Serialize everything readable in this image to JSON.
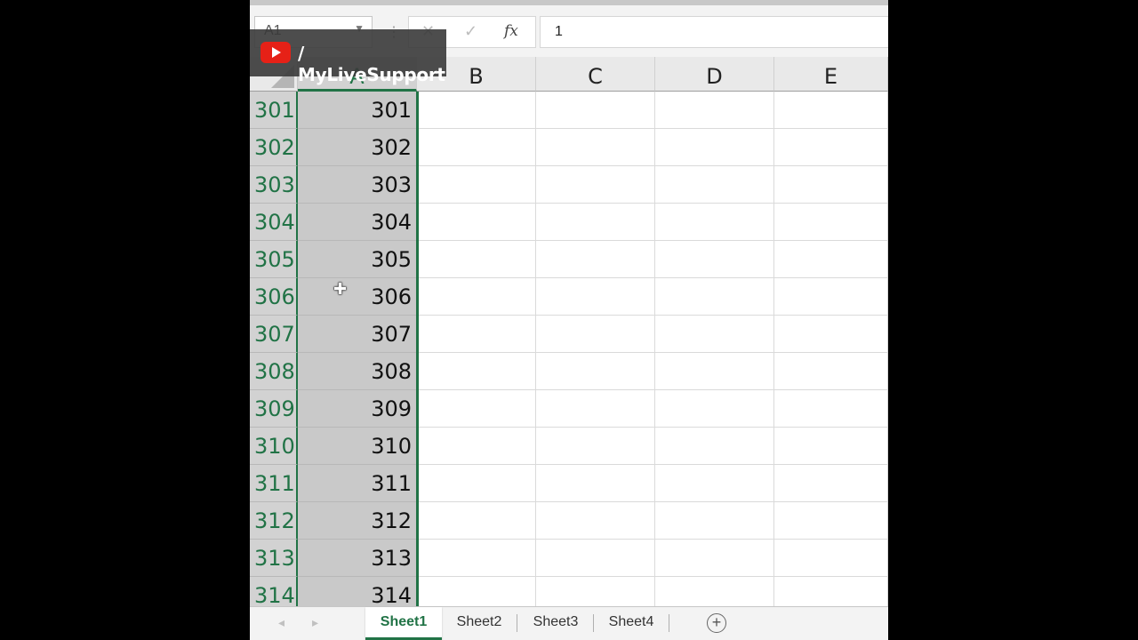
{
  "formula_bar": {
    "name_box": "A1",
    "cancel_icon": "✕",
    "enter_icon": "✓",
    "fx_label": "fx",
    "value": "1"
  },
  "watermark": {
    "text": "/ MyLiveSupport",
    "icon": "youtube-icon"
  },
  "columns": [
    {
      "label": "A"
    },
    {
      "label": "B"
    },
    {
      "label": "C"
    },
    {
      "label": "D"
    },
    {
      "label": "E"
    }
  ],
  "rows": [
    {
      "num": "301",
      "a": "301"
    },
    {
      "num": "302",
      "a": "302"
    },
    {
      "num": "303",
      "a": "303"
    },
    {
      "num": "304",
      "a": "304"
    },
    {
      "num": "305",
      "a": "305"
    },
    {
      "num": "306",
      "a": "306"
    },
    {
      "num": "307",
      "a": "307"
    },
    {
      "num": "308",
      "a": "308"
    },
    {
      "num": "309",
      "a": "309"
    },
    {
      "num": "310",
      "a": "310"
    },
    {
      "num": "311",
      "a": "311"
    },
    {
      "num": "312",
      "a": "312"
    },
    {
      "num": "313",
      "a": "313"
    },
    {
      "num": "314",
      "a": "314"
    }
  ],
  "sheets": [
    {
      "label": "Sheet1",
      "active": true
    },
    {
      "label": "Sheet2",
      "active": false
    },
    {
      "label": "Sheet3",
      "active": false
    },
    {
      "label": "Sheet4",
      "active": false
    }
  ],
  "colors": {
    "accent": "#217346",
    "selection": "#c9c9c9",
    "youtube": "#e62117"
  },
  "icons": {
    "add_sheet": "plus-circle-icon",
    "cursor": "cell-select-cursor-icon"
  }
}
